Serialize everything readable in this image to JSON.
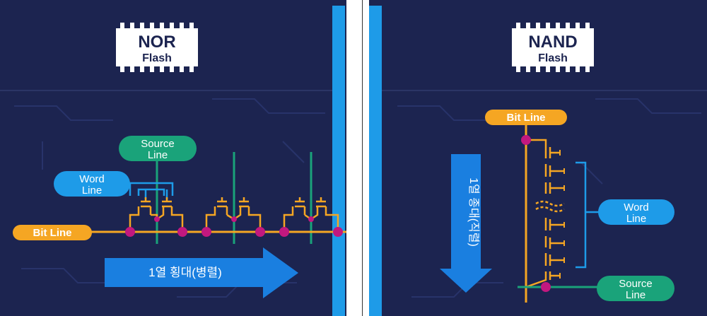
{
  "nor_panel": {
    "chip_title": "NOR",
    "chip_subtitle": "Flash",
    "source_line_label_1": "Source",
    "source_line_label_2": "Line",
    "word_line_label_1": "Word",
    "word_line_label_2": "Line",
    "bit_line_label": "Bit Line",
    "arrow_label": "1열 횡대(병렬)"
  },
  "nand_panel": {
    "chip_title": "NAND",
    "chip_subtitle": "Flash",
    "bit_line_label": "Bit Line",
    "word_line_label_1": "Word",
    "word_line_label_2": "Line",
    "source_line_label_1": "Source",
    "source_line_label_2": "Line",
    "arrow_label": "1열 종대(직렬)"
  },
  "colors": {
    "background": "#1c2450",
    "accent_blue": "#1e9be8",
    "line_orange": "#f5a623",
    "source_green": "#1aa37a",
    "node_magenta": "#c2187f",
    "arrow_blue": "#1a7fe0"
  }
}
